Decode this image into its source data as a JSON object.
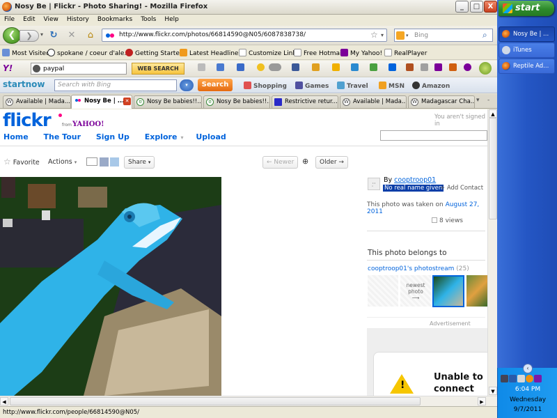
{
  "window": {
    "title": "Nosy Be | Flickr - Photo Sharing! - Mozilla Firefox",
    "minimize": "_",
    "maximize": "□",
    "close": "X"
  },
  "menu": [
    "File",
    "Edit",
    "View",
    "History",
    "Bookmarks",
    "Tools",
    "Help"
  ],
  "nav": {
    "url": "http://www.flickr.com/photos/66814590@N05/6087838738/",
    "search_placeholder": "Bing"
  },
  "bookmarks": [
    "Most Visited",
    "spokane / coeur d'ale...",
    "Getting Started",
    "Latest Headlines",
    "Customize Links",
    "Free Hotmail",
    "My Yahoo!",
    "RealPlayer"
  ],
  "yahoo_toolbar": {
    "logo": "Y!",
    "search_value": "paypal",
    "web_search": "WEB SEARCH"
  },
  "startnow": {
    "logo": "startnow",
    "placeholder": "Search with Bing",
    "search_btn": "Search",
    "links": [
      "Shopping",
      "Games",
      "Travel",
      "MSN",
      "Amazon"
    ]
  },
  "tabs": [
    {
      "label": "Available | Mada...",
      "active": false
    },
    {
      "label": "Nosy Be | ...",
      "active": true
    },
    {
      "label": "Nosy Be babies!!...",
      "active": false
    },
    {
      "label": "Nosy Be babies!!...",
      "active": false
    },
    {
      "label": "Restrictive retur...",
      "active": false
    },
    {
      "label": "Available | Mada...",
      "active": false
    },
    {
      "label": "Madagascar Cha...",
      "active": false
    }
  ],
  "flickr": {
    "logo": "flickr",
    "from": "from",
    "yahoo": "YAHOO!",
    "signin": "You aren't signed in",
    "nav": [
      "Home",
      "The Tour",
      "Sign Up",
      "Explore",
      "Upload"
    ],
    "actions": {
      "favorite": "Favorite",
      "actions": "Actions",
      "share": "Share",
      "newer": "← Newer",
      "older": "Older →"
    },
    "owner": {
      "by": "By",
      "name": "cooptroop01",
      "realname": "No real name given",
      "add_contact": "+ Add Contact"
    },
    "taken": "This photo was taken on",
    "taken_date": "August 27, 2011",
    "views": "8 views",
    "belongs": "This photo belongs to",
    "photostream": "cooptroop01's photostream",
    "photostream_count": "(25)",
    "newest": "newest photo",
    "newest_arrow": "⟶",
    "advertisement": "Advertisement",
    "ad_text": "Unable to connect"
  },
  "status_url": "http://www.flickr.com/people/66814590@N05/",
  "taskbar": {
    "start": "start",
    "items": [
      "Nosy Be | ...",
      "iTunes",
      "Reptile Ad..."
    ],
    "time": "6:04 PM",
    "day": "Wednesday",
    "date": "9/7/2011"
  },
  "colors": {
    "flickr_blue": "#0063dc",
    "flickr_pink": "#ff0084",
    "chameleon": "#2fb3e8"
  }
}
